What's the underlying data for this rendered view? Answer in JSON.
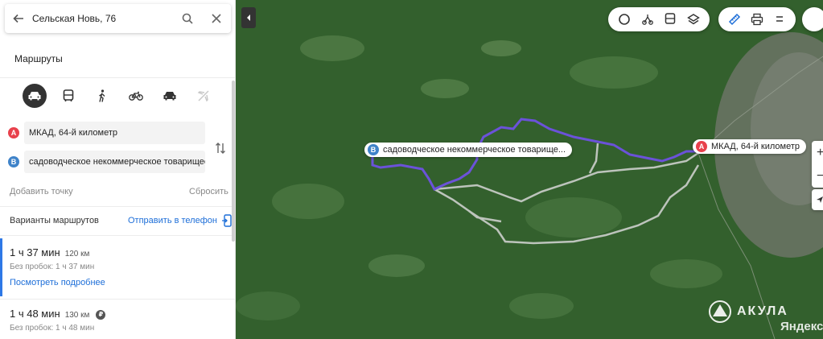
{
  "search": {
    "query": "Сельская Новь, 76"
  },
  "routes_header": "Маршруты",
  "transport_modes": [
    "car",
    "bus",
    "pedestrian",
    "bicycle",
    "taxi",
    "plane"
  ],
  "route_points": {
    "a": {
      "badge": "A",
      "value": "МКАД, 64-й километр"
    },
    "b": {
      "badge": "B",
      "value": "садоводческое некоммерческое товарищес..."
    }
  },
  "actions": {
    "add_point": "Добавить точку",
    "reset": "Сбросить"
  },
  "variants": {
    "title": "Варианты маршрутов",
    "send_to_phone": "Отправить в телефон"
  },
  "routes": [
    {
      "time": "1 ч 37 мин",
      "distance": "120 км",
      "no_traffic": "Без пробок: 1 ч 37 мин",
      "details_link": "Посмотреть подробнее",
      "toll": ""
    },
    {
      "time": "1 ч 48 мин",
      "distance": "130 км",
      "no_traffic": "Без пробок: 1 ч 48 мин",
      "toll": "₽"
    }
  ],
  "map": {
    "label_a": "МКАД, 64-й километр",
    "label_b": "садоводческое некоммерческое товарище...",
    "zoom_in": "+",
    "zoom_out": "−",
    "watermark": "АКУЛА",
    "provider": "Яндекс"
  },
  "colors": {
    "active_route": "#6b52d9",
    "alt_route": "#dddddd",
    "accent": "#1d6ed8",
    "pin_a": "#e8414c",
    "pin_b": "#3f83c9"
  }
}
